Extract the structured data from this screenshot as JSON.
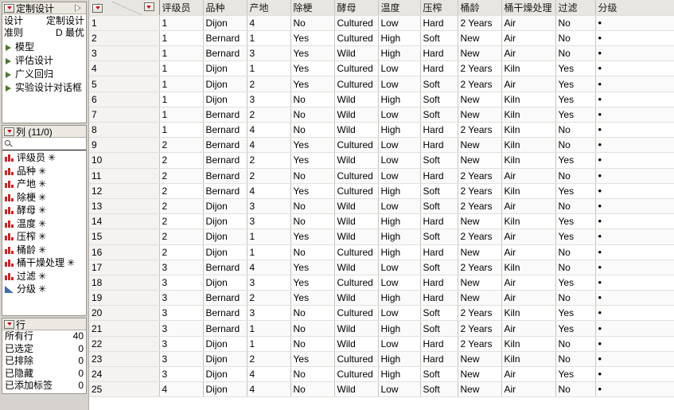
{
  "left_panel": {
    "design": {
      "header_title": "定制设计",
      "expand_icon": "triangle-right-icon",
      "rows": [
        {
          "label": "设计",
          "value": "定制设计"
        },
        {
          "label": "准则",
          "value": "D 最优"
        }
      ],
      "outline_items": [
        {
          "label": "模型"
        },
        {
          "label": "评估设计"
        },
        {
          "label": "广义回归"
        },
        {
          "label": "实验设计对话框"
        }
      ]
    },
    "columns": {
      "header_title": "列 (11/0)",
      "search_placeholder": "",
      "search_value": "",
      "items": [
        {
          "label": "评级员",
          "icon": "nominal-bars-icon",
          "marker": "✳"
        },
        {
          "label": "品种",
          "icon": "nominal-bars-icon",
          "marker": "✳"
        },
        {
          "label": "产地",
          "icon": "nominal-bars-icon",
          "marker": "✳"
        },
        {
          "label": "除梗",
          "icon": "nominal-bars-icon",
          "marker": "✳"
        },
        {
          "label": "酵母",
          "icon": "nominal-bars-icon",
          "marker": "✳"
        },
        {
          "label": "温度",
          "icon": "nominal-bars-icon",
          "marker": "✳"
        },
        {
          "label": "压榨",
          "icon": "nominal-bars-icon",
          "marker": "✳"
        },
        {
          "label": "桶龄",
          "icon": "nominal-bars-icon",
          "marker": "✳"
        },
        {
          "label": "桶干燥处理",
          "icon": "nominal-bars-icon",
          "marker": "✳"
        },
        {
          "label": "过滤",
          "icon": "nominal-bars-icon",
          "marker": "✳"
        },
        {
          "label": "分级",
          "icon": "continuous-triangle-icon",
          "marker": "✳"
        }
      ]
    },
    "rows": {
      "header_title": "行",
      "stats": [
        {
          "label": "所有行",
          "value": "40"
        },
        {
          "label": "已选定",
          "value": "0"
        },
        {
          "label": "已排除",
          "value": "0"
        },
        {
          "label": "已隐藏",
          "value": "0"
        },
        {
          "label": "已添加标签",
          "value": "0"
        }
      ]
    }
  },
  "table": {
    "columns": [
      "评级员",
      "品种",
      "产地",
      "除梗",
      "酵母",
      "温度",
      "压榨",
      "桶龄",
      "桶干燥处理",
      "过滤",
      "分级"
    ],
    "missing_marker": "•",
    "rows": [
      {
        "n": "1",
        "cells": [
          "1",
          "Dijon",
          "4",
          "No",
          "Cultured",
          "Low",
          "Hard",
          "2 Years",
          "Air",
          "No",
          ""
        ]
      },
      {
        "n": "2",
        "cells": [
          "1",
          "Bernard",
          "1",
          "Yes",
          "Cultured",
          "High",
          "Soft",
          "New",
          "Air",
          "No",
          ""
        ]
      },
      {
        "n": "3",
        "cells": [
          "1",
          "Bernard",
          "3",
          "Yes",
          "Wild",
          "High",
          "Hard",
          "New",
          "Air",
          "No",
          ""
        ]
      },
      {
        "n": "4",
        "cells": [
          "1",
          "Dijon",
          "1",
          "Yes",
          "Cultured",
          "Low",
          "Hard",
          "2 Years",
          "Kiln",
          "Yes",
          ""
        ]
      },
      {
        "n": "5",
        "cells": [
          "1",
          "Dijon",
          "2",
          "Yes",
          "Cultured",
          "Low",
          "Soft",
          "2 Years",
          "Air",
          "Yes",
          ""
        ]
      },
      {
        "n": "6",
        "cells": [
          "1",
          "Dijon",
          "3",
          "No",
          "Wild",
          "High",
          "Soft",
          "New",
          "Kiln",
          "Yes",
          ""
        ]
      },
      {
        "n": "7",
        "cells": [
          "1",
          "Bernard",
          "2",
          "No",
          "Wild",
          "Low",
          "Soft",
          "New",
          "Kiln",
          "Yes",
          ""
        ]
      },
      {
        "n": "8",
        "cells": [
          "1",
          "Bernard",
          "4",
          "No",
          "Wild",
          "High",
          "Hard",
          "2 Years",
          "Kiln",
          "No",
          ""
        ]
      },
      {
        "n": "9",
        "cells": [
          "2",
          "Bernard",
          "4",
          "Yes",
          "Cultured",
          "Low",
          "Hard",
          "New",
          "Kiln",
          "No",
          ""
        ]
      },
      {
        "n": "10",
        "cells": [
          "2",
          "Bernard",
          "2",
          "Yes",
          "Wild",
          "Low",
          "Soft",
          "New",
          "Kiln",
          "Yes",
          ""
        ]
      },
      {
        "n": "11",
        "cells": [
          "2",
          "Bernard",
          "2",
          "No",
          "Cultured",
          "Low",
          "Hard",
          "2 Years",
          "Air",
          "No",
          ""
        ]
      },
      {
        "n": "12",
        "cells": [
          "2",
          "Bernard",
          "4",
          "Yes",
          "Cultured",
          "High",
          "Soft",
          "2 Years",
          "Kiln",
          "Yes",
          ""
        ]
      },
      {
        "n": "13",
        "cells": [
          "2",
          "Dijon",
          "3",
          "No",
          "Wild",
          "Low",
          "Soft",
          "2 Years",
          "Air",
          "No",
          ""
        ]
      },
      {
        "n": "14",
        "cells": [
          "2",
          "Dijon",
          "3",
          "No",
          "Wild",
          "High",
          "Hard",
          "New",
          "Kiln",
          "Yes",
          ""
        ]
      },
      {
        "n": "15",
        "cells": [
          "2",
          "Dijon",
          "1",
          "Yes",
          "Wild",
          "High",
          "Soft",
          "2 Years",
          "Air",
          "Yes",
          ""
        ]
      },
      {
        "n": "16",
        "cells": [
          "2",
          "Dijon",
          "1",
          "No",
          "Cultured",
          "High",
          "Hard",
          "New",
          "Air",
          "No",
          ""
        ]
      },
      {
        "n": "17",
        "cells": [
          "3",
          "Bernard",
          "4",
          "Yes",
          "Wild",
          "Low",
          "Soft",
          "2 Years",
          "Kiln",
          "No",
          ""
        ]
      },
      {
        "n": "18",
        "cells": [
          "3",
          "Dijon",
          "3",
          "Yes",
          "Cultured",
          "Low",
          "Hard",
          "New",
          "Air",
          "Yes",
          ""
        ]
      },
      {
        "n": "19",
        "cells": [
          "3",
          "Bernard",
          "2",
          "Yes",
          "Wild",
          "High",
          "Hard",
          "New",
          "Air",
          "No",
          ""
        ]
      },
      {
        "n": "20",
        "cells": [
          "3",
          "Bernard",
          "3",
          "No",
          "Cultured",
          "Low",
          "Soft",
          "2 Years",
          "Kiln",
          "Yes",
          ""
        ]
      },
      {
        "n": "21",
        "cells": [
          "3",
          "Bernard",
          "1",
          "No",
          "Wild",
          "High",
          "Soft",
          "2 Years",
          "Air",
          "Yes",
          ""
        ]
      },
      {
        "n": "22",
        "cells": [
          "3",
          "Dijon",
          "1",
          "No",
          "Wild",
          "Low",
          "Hard",
          "2 Years",
          "Kiln",
          "No",
          ""
        ]
      },
      {
        "n": "23",
        "cells": [
          "3",
          "Dijon",
          "2",
          "Yes",
          "Cultured",
          "High",
          "Hard",
          "New",
          "Kiln",
          "No",
          ""
        ]
      },
      {
        "n": "24",
        "cells": [
          "3",
          "Dijon",
          "4",
          "No",
          "Cultured",
          "High",
          "Soft",
          "New",
          "Air",
          "Yes",
          ""
        ]
      },
      {
        "n": "25",
        "cells": [
          "4",
          "Dijon",
          "4",
          "No",
          "Wild",
          "Low",
          "Soft",
          "New",
          "Air",
          "No",
          ""
        ]
      }
    ]
  }
}
